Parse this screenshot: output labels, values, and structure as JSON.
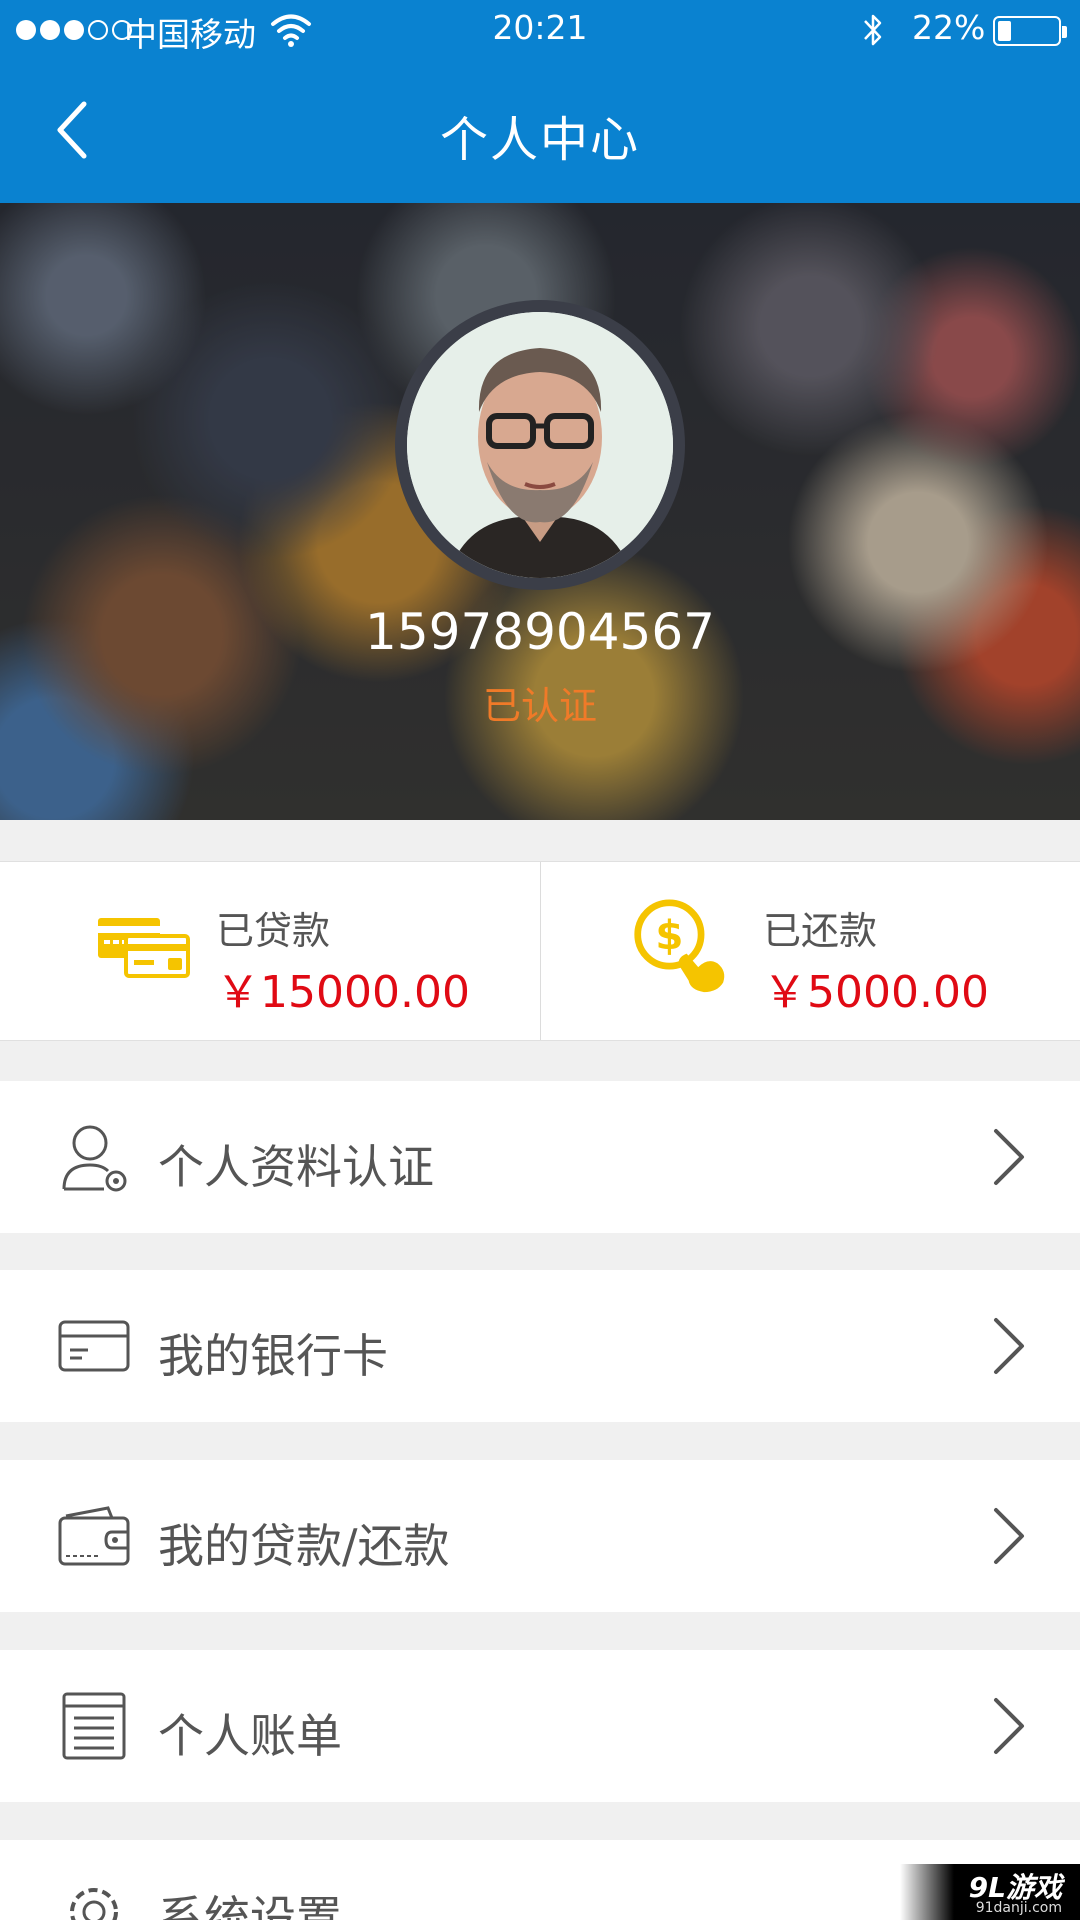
{
  "status_bar": {
    "carrier": "中国移动",
    "time": "20:21",
    "battery_percent": "22%",
    "battery_level": 0.22,
    "signal_bars_filled": 3,
    "signal_bars_total": 5
  },
  "nav": {
    "title": "个人中心",
    "back_icon": "chevron-left-icon"
  },
  "profile": {
    "phone": "15978904567",
    "verification_status": "已认证",
    "verification_color": "#f07a28"
  },
  "stats": {
    "borrowed": {
      "label": "已贷款",
      "value": "￥15000.00",
      "icon": "credit-card-icon"
    },
    "repaid": {
      "label": "已还款",
      "value": "￥5000.00",
      "icon": "dollar-coin-hand-icon"
    },
    "value_color": "#e00a14",
    "icon_color": "#f5c400"
  },
  "menu": [
    {
      "label": "个人资料认证",
      "icon": "user-settings-icon"
    },
    {
      "label": "我的银行卡",
      "icon": "bank-card-icon"
    },
    {
      "label": "我的贷款/还款",
      "icon": "wallet-icon"
    },
    {
      "label": "个人账单",
      "icon": "bill-list-icon"
    },
    {
      "label": "系统设置",
      "icon": "gear-icon"
    }
  ],
  "watermark": {
    "title": "9L游戏",
    "subtitle": "91danji.com"
  },
  "colors": {
    "primary": "#0a82d0",
    "background": "#f0f0f0"
  }
}
